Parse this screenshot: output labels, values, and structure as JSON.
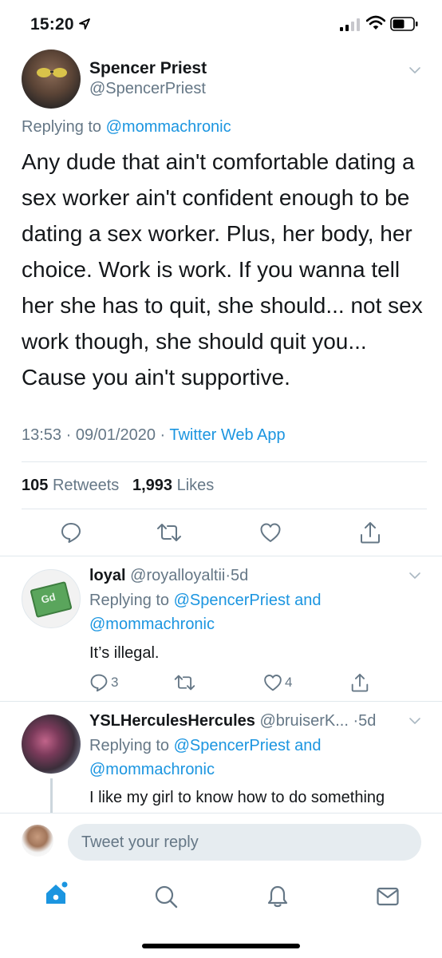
{
  "status_bar": {
    "time": "15:20"
  },
  "main_tweet": {
    "display_name": "Spencer Priest",
    "handle": "@SpencerPriest",
    "replying_prefix": "Replying to",
    "replying_to": "@mommachronic",
    "text": "Any dude that ain't comfortable dating a sex worker ain't confident enough to be dating a sex worker. Plus, her body, her choice. Work is work. If you wanna tell her she has to quit, she should... not sex work though, she should quit you... Cause you ain't supportive.",
    "time": "13:53",
    "date": "09/01/2020",
    "source": "Twitter Web App",
    "retweets_count": "105",
    "retweets_label": "Retweets",
    "likes_count": "1,993",
    "likes_label": "Likes"
  },
  "replies": [
    {
      "display_name": "loyal",
      "handle": "@royalloyaltii",
      "age": "5d",
      "replying_prefix": "Replying to",
      "replying_to_1": "@SpencerPriest",
      "replying_and": "and",
      "replying_to_2": "@mommachronic",
      "text": "It’s illegal.",
      "reply_count": "3",
      "like_count": "4",
      "avatar_symbol": "Gd"
    },
    {
      "display_name": "YSLHerculesHercules",
      "handle": "@bruiserK...",
      "age": "5d",
      "replying_prefix": "Replying to",
      "replying_to_1": "@SpencerPriest",
      "replying_and": "and",
      "replying_to_2": "@mommachronic",
      "text": "I like my girl to know how to do something"
    }
  ],
  "composer": {
    "placeholder": "Tweet your reply"
  },
  "colors": {
    "accent": "#1b95e0",
    "secondary_text": "#657786",
    "divider": "#e1e8ed",
    "icon": "#657786"
  },
  "icons": [
    "location-arrow-icon",
    "signal-icon",
    "wifi-icon",
    "battery-icon",
    "chevron-down-icon",
    "reply-icon",
    "retweet-icon",
    "like-icon",
    "share-icon",
    "home-icon",
    "search-icon",
    "notifications-icon",
    "messages-icon"
  ]
}
